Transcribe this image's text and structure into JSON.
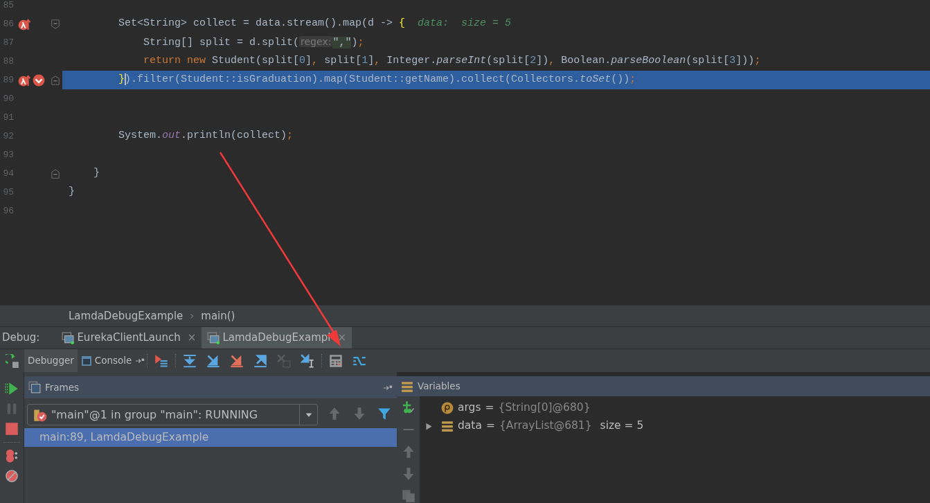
{
  "editor": {
    "lines": [
      {
        "number": "85"
      },
      {
        "number": "86",
        "breakpoints": [
          {
            "kind": "lambda"
          }
        ],
        "fold_start": true,
        "tokens": [
          {
            "kind": "plain",
            "text": "        Set<String> collect = data.stream().map(d -> "
          },
          {
            "kind": "brace",
            "text": "{"
          },
          {
            "kind": "debug",
            "text": "  data:  size = 5"
          }
        ]
      },
      {
        "number": "87",
        "tokens": [
          {
            "kind": "plain",
            "text": "            String[] split = d.split("
          },
          {
            "kind": "param",
            "text": "regex:"
          },
          {
            "kind": "string",
            "text": "\",\""
          },
          {
            "kind": "plain",
            "text": ")"
          },
          {
            "kind": "punct",
            "text": ";"
          }
        ]
      },
      {
        "number": "88",
        "tokens": [
          {
            "kind": "keyword",
            "text": "            return new"
          },
          {
            "kind": "plain",
            "text": " Student(split["
          },
          {
            "kind": "number",
            "text": "0"
          },
          {
            "kind": "plain",
            "text": "]"
          },
          {
            "kind": "punct",
            "text": ", "
          },
          {
            "kind": "plain",
            "text": "split["
          },
          {
            "kind": "number",
            "text": "1"
          },
          {
            "kind": "plain",
            "text": "]"
          },
          {
            "kind": "punct",
            "text": ", "
          },
          {
            "kind": "plain",
            "text": "Integer."
          },
          {
            "kind": "static",
            "text": "parseInt"
          },
          {
            "kind": "plain",
            "text": "(split["
          },
          {
            "kind": "number",
            "text": "2"
          },
          {
            "kind": "plain",
            "text": "])"
          },
          {
            "kind": "punct",
            "text": ", "
          },
          {
            "kind": "plain",
            "text": "Boolean."
          },
          {
            "kind": "static",
            "text": "parseBoolean"
          },
          {
            "kind": "plain",
            "text": "(split["
          },
          {
            "kind": "number",
            "text": "3"
          },
          {
            "kind": "plain",
            "text": "]))"
          },
          {
            "kind": "punct",
            "text": ";"
          }
        ]
      },
      {
        "number": "89",
        "current": true,
        "breakpoints": [
          {
            "kind": "lambda"
          },
          {
            "kind": "line"
          }
        ],
        "fold_end": true,
        "tokens": [
          {
            "kind": "brace",
            "text": "        }",
            "caret": true
          },
          {
            "kind": "plain",
            "text": ").filter(Student::isGraduation).map(Student::getName).collect(Collectors."
          },
          {
            "kind": "static",
            "text": "toSet"
          },
          {
            "kind": "plain",
            "text": "())"
          },
          {
            "kind": "punct",
            "text": ";"
          }
        ]
      },
      {
        "number": "90"
      },
      {
        "number": "91"
      },
      {
        "number": "92",
        "tokens": [
          {
            "kind": "plain",
            "text": "        System."
          },
          {
            "kind": "field",
            "text": "out"
          },
          {
            "kind": "plain",
            "text": ".println(collect)"
          },
          {
            "kind": "punct",
            "text": ";"
          }
        ]
      },
      {
        "number": "93"
      },
      {
        "number": "94",
        "fold_end": true,
        "tokens": [
          {
            "kind": "plain",
            "text": "    }"
          }
        ]
      },
      {
        "number": "95",
        "tokens": [
          {
            "kind": "plain",
            "text": "}"
          }
        ]
      },
      {
        "number": "96"
      }
    ]
  },
  "breadcrumb": {
    "items": [
      "LamdaDebugExample",
      "main()"
    ],
    "separator": "›"
  },
  "debug": {
    "label": "Debug:",
    "tabs": [
      {
        "label": "EurekaClientLaunch",
        "close": "×",
        "selected": false
      },
      {
        "label": "LamdaDebugExampl",
        "close": "×",
        "selected": true
      }
    ],
    "views": [
      {
        "label": "Debugger",
        "selected": true
      },
      {
        "label": "Console",
        "selected": false
      }
    ],
    "toolbar": [
      {
        "kind": "exec-point",
        "disabled": false
      },
      {
        "kind": "sep"
      },
      {
        "kind": "step-over",
        "disabled": false
      },
      {
        "kind": "step-into",
        "disabled": false
      },
      {
        "kind": "force-into",
        "disabled": false
      },
      {
        "kind": "step-out",
        "disabled": false
      },
      {
        "kind": "drop-frame",
        "disabled": true
      },
      {
        "kind": "run-cursor",
        "disabled": false
      },
      {
        "kind": "sep"
      },
      {
        "kind": "evaluate",
        "disabled": false
      },
      {
        "kind": "trace",
        "disabled": false
      }
    ],
    "side": [
      {
        "kind": "resume",
        "disabled": false
      },
      {
        "kind": "pause",
        "disabled": true
      },
      {
        "kind": "stop",
        "disabled": false
      },
      {
        "kind": "sep"
      },
      {
        "kind": "breakpoints",
        "disabled": false
      },
      {
        "kind": "mute",
        "disabled": false
      }
    ],
    "frames": {
      "title": "Frames",
      "thread": "\"main\"@1 in group \"main\": RUNNING",
      "nav": [
        {
          "kind": "up",
          "disabled": true
        },
        {
          "kind": "down",
          "disabled": true
        },
        {
          "kind": "filter",
          "disabled": false
        }
      ],
      "items": [
        {
          "text": "main:89, LamdaDebugExample",
          "selected": true
        }
      ]
    },
    "variables": {
      "title": "Variables",
      "tools": [
        {
          "kind": "add",
          "disabled": false
        },
        {
          "kind": "minus",
          "disabled": true
        },
        {
          "kind": "up",
          "disabled": true
        },
        {
          "kind": "down",
          "disabled": true
        },
        {
          "kind": "copy",
          "disabled": true
        }
      ],
      "items": [
        {
          "kind": "parameter",
          "name": "args",
          "operator": "=",
          "value": "{String[0]@680}"
        },
        {
          "kind": "field",
          "name": "data",
          "operator": "=",
          "value": "{ArrayList@681}",
          "extra": "size = 5",
          "expandable": true
        }
      ]
    }
  }
}
